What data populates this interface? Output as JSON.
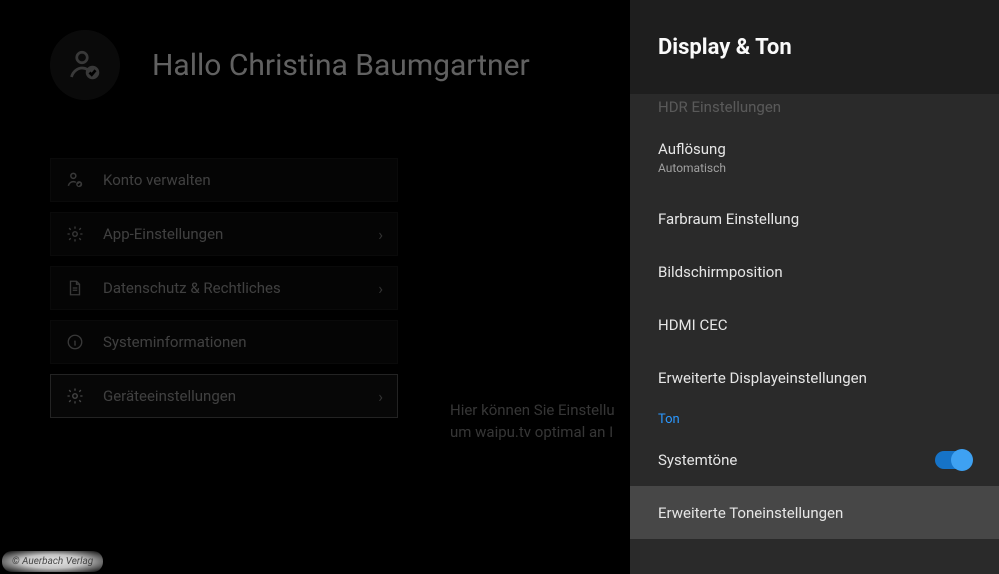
{
  "profile": {
    "greeting": "Hallo Christina Baumgartner"
  },
  "menu": {
    "items": [
      {
        "label": "Konto verwalten",
        "icon": "user-check",
        "chevron": false
      },
      {
        "label": "App-Einstellungen",
        "icon": "gear",
        "chevron": true
      },
      {
        "label": "Datenschutz & Rechtliches",
        "icon": "document",
        "chevron": true
      },
      {
        "label": "Systeminformationen",
        "icon": "info",
        "chevron": false
      },
      {
        "label": "Geräteeinstellungen",
        "icon": "gear",
        "chevron": true,
        "selected": true
      }
    ]
  },
  "helper": {
    "line1": "Hier können Sie Einstellu",
    "line2": "um waipu.tv optimal an I"
  },
  "panel": {
    "title": "Display & Ton",
    "faded_row": "HDR Einstellungen",
    "rows": [
      {
        "label": "Auflösung",
        "sublabel": "Automatisch"
      },
      {
        "label": "Farbraum Einstellung"
      },
      {
        "label": "Bildschirmposition"
      },
      {
        "label": "HDMI CEC"
      },
      {
        "label": "Erweiterte Displayeinstellungen"
      }
    ],
    "section_ton": "Ton",
    "systemtone": {
      "label": "Systemtöne",
      "on": true
    },
    "selected_row": "Erweiterte Toneinstellungen"
  },
  "watermark": "© Auerbach Verlag"
}
